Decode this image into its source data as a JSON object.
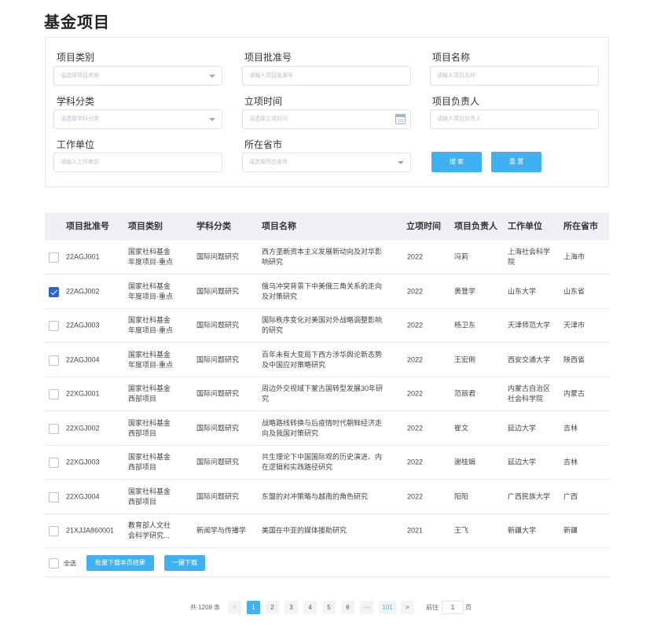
{
  "page": {
    "title": "基金项目"
  },
  "filters": {
    "category": {
      "label": "项目类别",
      "placeholder": "请选择项目类别"
    },
    "approval_no": {
      "label": "项目批准号",
      "placeholder": "请输入项目批准号"
    },
    "project_name": {
      "label": "项目名称",
      "placeholder": "请输入项目名称"
    },
    "discipline": {
      "label": "学科分类",
      "placeholder": "请选择学科分类"
    },
    "start_time": {
      "label": "立项时间",
      "placeholder": "请选择立项时间"
    },
    "leader": {
      "label": "项目负责人",
      "placeholder": "请输入项目负责人"
    },
    "work_unit": {
      "label": "工作单位",
      "placeholder": "请输入工作单位"
    },
    "province": {
      "label": "所在省市",
      "placeholder": "请选择所在省市"
    },
    "search_label": "搜 索",
    "reset_label": "重 置"
  },
  "table": {
    "headers": [
      "项目批准号",
      "项目类别",
      "学科分类",
      "项目名称",
      "立项时间",
      "项目负责人",
      "工作单位",
      "所在省市"
    ],
    "rows": [
      {
        "checked": false,
        "no": "22AGJ001",
        "category": [
          "国家社科基金",
          "年度项目-重点"
        ],
        "discipline": "国际问题研究",
        "name": [
          "西方垄断资本主义发展新动向及对华影",
          "响研究"
        ],
        "year": "2022",
        "leader": "冯莉",
        "unit": [
          "上海社会科学",
          "院"
        ],
        "province": "上海市"
      },
      {
        "checked": true,
        "no": "22AGJ002",
        "category": [
          "国家社科基金",
          "年度项目-重点"
        ],
        "discipline": "国际问题研究",
        "name": [
          "俄乌冲突背景下中美俄三角关系的走向",
          "及对策研究"
        ],
        "year": "2022",
        "leader": "黄登学",
        "unit": [
          "山东大学"
        ],
        "province": "山东省"
      },
      {
        "checked": false,
        "no": "22AGJ003",
        "category": [
          "国家社科基金",
          "年度项目-重点"
        ],
        "discipline": "国际问题研究",
        "name": [
          "国际秩序变化对美国对外战略调整影响",
          "的研究"
        ],
        "year": "2022",
        "leader": "杨卫东",
        "unit": [
          "天津师范大学"
        ],
        "province": "天津市"
      },
      {
        "checked": false,
        "no": "22AGJ004",
        "category": [
          "国家社科基金",
          "年度项目-重点"
        ],
        "discipline": "国际问题研究",
        "name": [
          "百年未有大变局下西方涉华舆论新态势",
          "及中国应对策略研究"
        ],
        "year": "2022",
        "leader": "王宏俐",
        "unit": [
          "西安交通大学"
        ],
        "province": "陕西省"
      },
      {
        "checked": false,
        "no": "22XGJ001",
        "category": [
          "国家社科基金",
          "西部项目"
        ],
        "discipline": "国际问题研究",
        "name": [
          "周边外交视域下蒙古国转型发展30年研",
          "究"
        ],
        "year": "2022",
        "leader": "范丽君",
        "unit": [
          "内蒙古自治区",
          "社会科学院"
        ],
        "province": "内蒙古"
      },
      {
        "checked": false,
        "no": "22XGJ002",
        "category": [
          "国家社科基金",
          "西部项目"
        ],
        "discipline": "国际问题研究",
        "name": [
          "战略路线转换与后疫情时代朝鲜经济走",
          "向及我国对策研究"
        ],
        "year": "2022",
        "leader": "崔文",
        "unit": [
          "延边大学"
        ],
        "province": "吉林"
      },
      {
        "checked": false,
        "no": "22XGJ003",
        "category": [
          "国家社科基金",
          "西部项目"
        ],
        "discipline": "国际问题研究",
        "name": [
          "共生理论下中国国际观的历史演进、内",
          "在逻辑和实践路径研究"
        ],
        "year": "2022",
        "leader": "谢桂娟",
        "unit": [
          "延边大学"
        ],
        "province": "吉林"
      },
      {
        "checked": false,
        "no": "22XGJ004",
        "category": [
          "国家社科基金",
          "西部项目"
        ],
        "discipline": "国际问题研究",
        "name": [
          "东盟的对冲策略与越南的角色研究"
        ],
        "year": "2022",
        "leader": "阳阳",
        "unit": [
          "广西民族大学"
        ],
        "province": "广西"
      },
      {
        "checked": false,
        "no": "21XJJA860001",
        "category": [
          "教育部人文社",
          "会科学研究..."
        ],
        "discipline": "新闻学与传播学",
        "name": [
          "美国在中亚的媒体援助研究"
        ],
        "year": "2021",
        "leader": "王飞",
        "unit": [
          "新疆大学"
        ],
        "province": "新疆"
      }
    ]
  },
  "footer": {
    "select_all_label": "全选",
    "batch_download_label": "批量下载本页结果",
    "one_click_download_label": "一键下载"
  },
  "pagination": {
    "total_text": "共 1208 条",
    "prev": "<",
    "pages": [
      "1",
      "2",
      "3",
      "4",
      "5",
      "6"
    ],
    "ellipsis": "···",
    "last_page": "101",
    "next": ">",
    "goto_prefix": "前往",
    "goto_value": "1",
    "goto_suffix": "页",
    "active_page": "1"
  },
  "colors": {
    "primary": "#3fb1f0",
    "checkbox_checked": "#2e66c8",
    "header_bg": "#eef0f3"
  }
}
